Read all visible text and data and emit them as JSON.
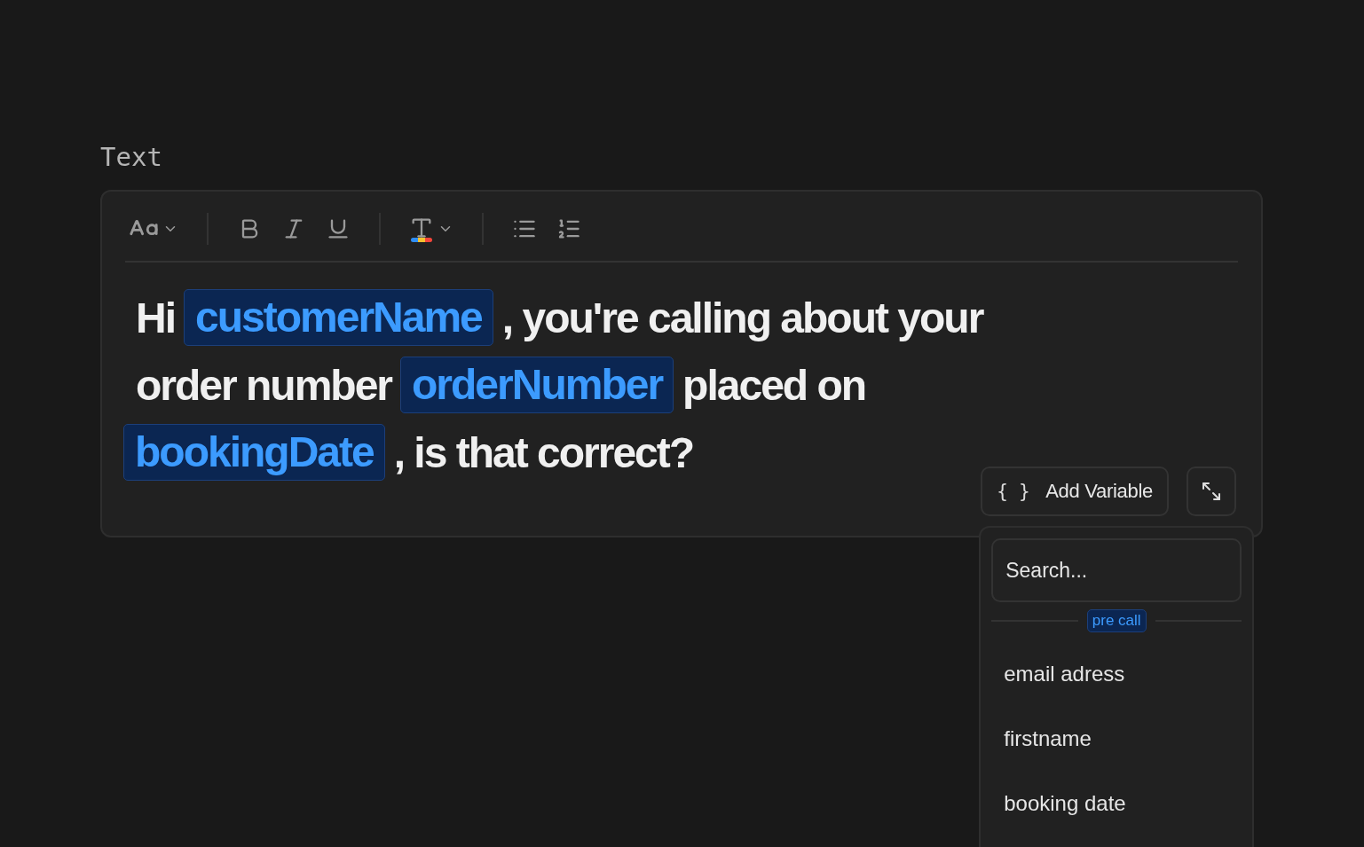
{
  "field_label": "Text",
  "toolbar": [
    {
      "kind": "font-size",
      "dropdown": true
    },
    {
      "kind": "divider"
    },
    {
      "kind": "bold"
    },
    {
      "kind": "italic"
    },
    {
      "kind": "underline"
    },
    {
      "kind": "divider"
    },
    {
      "kind": "text-color",
      "dropdown": true
    },
    {
      "kind": "divider"
    },
    {
      "kind": "bullet-list"
    },
    {
      "kind": "numbered-list"
    }
  ],
  "content_lines": [
    [
      {
        "kind": "text",
        "text": "Hi"
      },
      {
        "kind": "variable",
        "text": "customerName"
      },
      {
        "kind": "text",
        "text": ", you're calling about your"
      }
    ],
    [
      {
        "kind": "text",
        "text": "order number"
      },
      {
        "kind": "variable",
        "text": "orderNumber"
      },
      {
        "kind": "text",
        "text": "placed on"
      }
    ],
    [
      {
        "kind": "variable",
        "text": "bookingDate"
      },
      {
        "kind": "text",
        "text": ", is that correct?"
      }
    ]
  ],
  "add_variable": {
    "icon": "{ }",
    "label": "Add Variable"
  },
  "variable_menu": {
    "search": {
      "placeholder": "Search..."
    },
    "group": "pre call",
    "items": [
      "email adress",
      "firstname",
      "booking date"
    ]
  }
}
